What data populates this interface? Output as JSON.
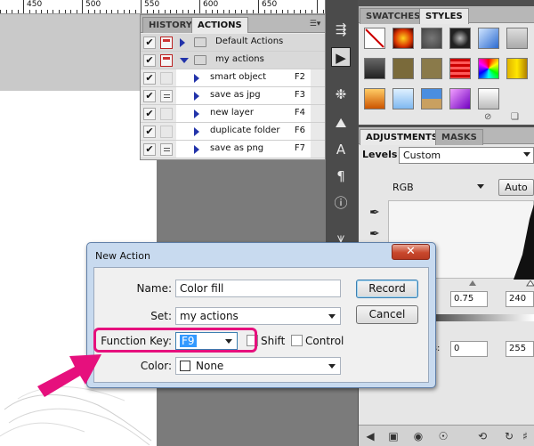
{
  "ruler": {
    "labels": [
      "450",
      "500",
      "550",
      "600",
      "650"
    ]
  },
  "actions_panel": {
    "tabs": [
      "HISTORY",
      "ACTIONS"
    ],
    "active_tab": "ACTIONS",
    "menu_icon": "panel-menu-icon",
    "rows": [
      {
        "label": "Default Actions",
        "type": "set",
        "expanded": false,
        "checked": true,
        "dialog": "red",
        "key": ""
      },
      {
        "label": "my actions",
        "type": "set",
        "expanded": true,
        "checked": true,
        "dialog": "red",
        "key": ""
      },
      {
        "label": "smart object",
        "type": "action",
        "checked": true,
        "dialog": "none",
        "key": "F2"
      },
      {
        "label": "save as jpg",
        "type": "action",
        "checked": true,
        "dialog": "dots",
        "key": "F3"
      },
      {
        "label": "new layer",
        "type": "action",
        "checked": true,
        "dialog": "none",
        "key": "F4"
      },
      {
        "label": "duplicate folder",
        "type": "action",
        "checked": true,
        "dialog": "none",
        "key": "F6"
      },
      {
        "label": "save as png",
        "type": "action",
        "checked": true,
        "dialog": "dots",
        "key": "F7"
      }
    ]
  },
  "tools_icons": [
    "history-brush-icon",
    "play-icon",
    "settings-wheel-icon",
    "image-icon",
    "text-icon",
    "paragraph-icon",
    "info-icon",
    "path-icon"
  ],
  "swatches_panel": {
    "tabs": [
      "SWATCHES",
      "STYLES"
    ],
    "active_tab": "STYLES"
  },
  "adjustments_panel": {
    "tabs": [
      "ADJUSTMENTS",
      "MASKS"
    ],
    "active_tab": "ADJUSTMENTS",
    "levels_label": "Levels",
    "preset": "Custom",
    "channel": "RGB",
    "auto_button": "Auto",
    "input_mid": "0.75",
    "input_high": "240",
    "output_label": "ls:",
    "output_low": "0",
    "output_high": "255"
  },
  "dialog": {
    "title": "New Action",
    "close_icon": "close-icon",
    "name_label": "Name:",
    "name_value": "Color fill",
    "set_label": "Set:",
    "set_value": "my actions",
    "function_key_label": "Function Key:",
    "function_key_value": "F9",
    "shift_label": "Shift",
    "control_label": "Control",
    "color_label": "Color:",
    "color_value": "None",
    "record_button": "Record",
    "cancel_button": "Cancel",
    "highlight_color": "#e6107d"
  }
}
